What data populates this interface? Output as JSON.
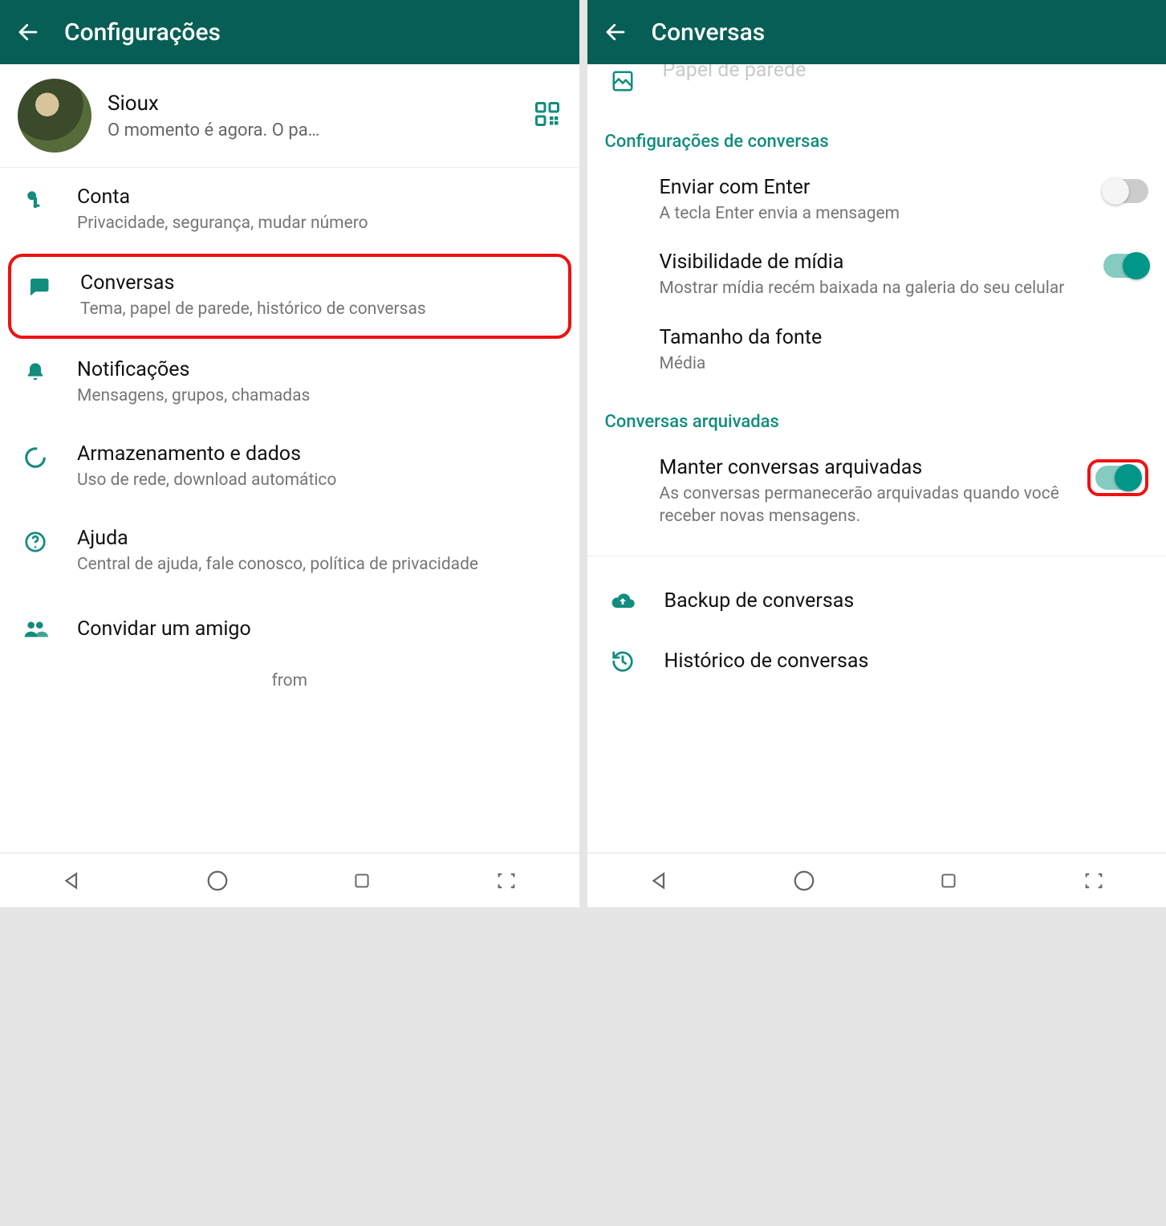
{
  "left": {
    "header_title": "Configurações",
    "profile": {
      "name": "Sioux",
      "status": "O momento é agora. O pa…"
    },
    "items": {
      "conta": {
        "label": "Conta",
        "desc": "Privacidade, segurança, mudar número"
      },
      "conversas": {
        "label": "Conversas",
        "desc": "Tema, papel de parede, histórico de conversas"
      },
      "notificacoes": {
        "label": "Notificações",
        "desc": "Mensagens, grupos, chamadas"
      },
      "armazenamento": {
        "label": "Armazenamento e dados",
        "desc": "Uso de rede, download automático"
      },
      "ajuda": {
        "label": "Ajuda",
        "desc": "Central de ajuda, fale conosco, política de privacidade"
      }
    },
    "invite_label": "Convidar um amigo",
    "from_label": "from"
  },
  "right": {
    "header_title": "Conversas",
    "partial_item_label": "Papel de parede",
    "section1_header": "Configurações de conversas",
    "settings": {
      "enter": {
        "label": "Enviar com Enter",
        "desc": "A tecla Enter envia a mensagem",
        "on": false
      },
      "media": {
        "label": "Visibilidade de mídia",
        "desc": "Mostrar mídia recém baixada na galeria do seu celular",
        "on": true
      },
      "font": {
        "label": "Tamanho da fonte",
        "desc": "Média"
      }
    },
    "section2_header": "Conversas arquivadas",
    "archived": {
      "label": "Manter conversas arquivadas",
      "desc": "As conversas permanecerão arquivadas quando você receber novas mensagens.",
      "on": true
    },
    "links": {
      "backup": "Backup de conversas",
      "history": "Histórico de conversas"
    }
  }
}
